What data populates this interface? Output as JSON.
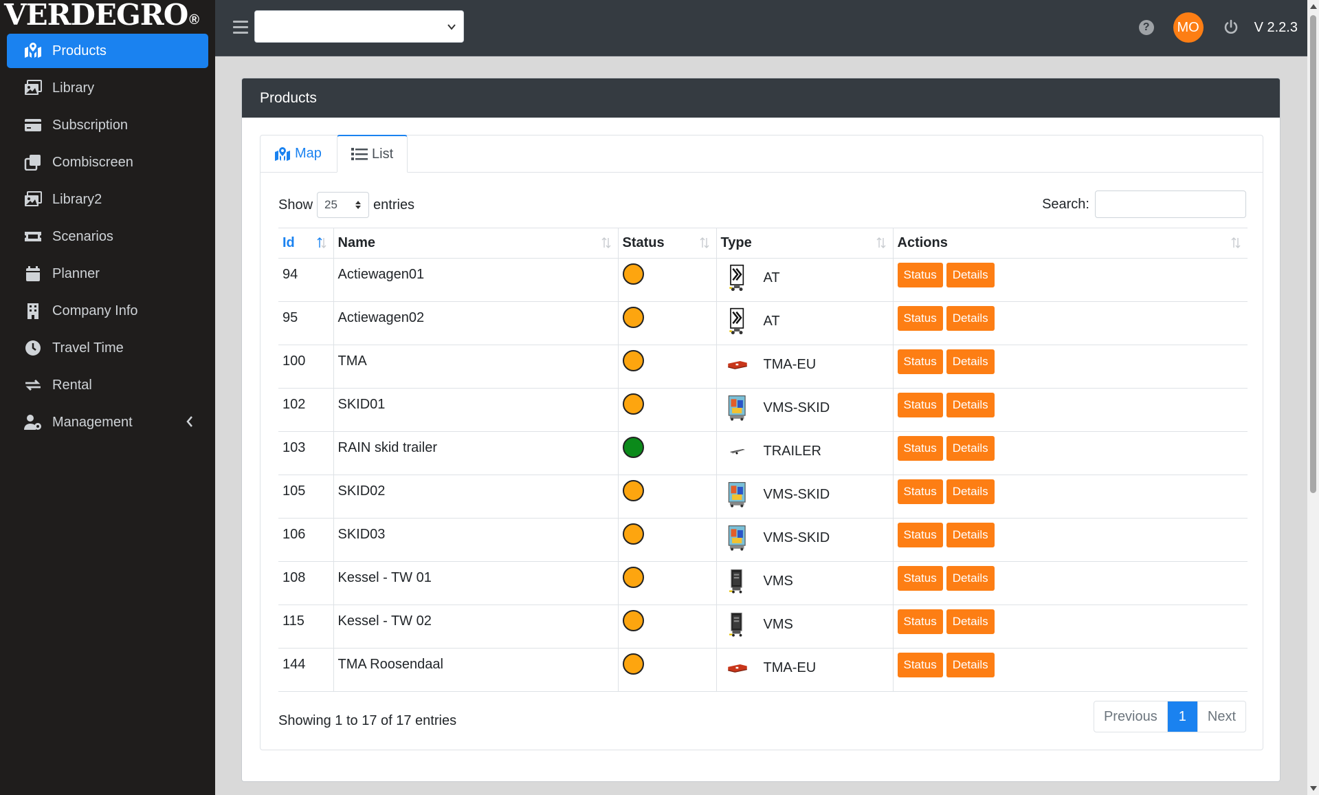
{
  "brand": {
    "logo": "VERDEGRO",
    "reg": "®"
  },
  "sidebar": {
    "items": [
      {
        "label": "Products",
        "icon": "map-marked-icon",
        "active": true
      },
      {
        "label": "Library",
        "icon": "images-icon"
      },
      {
        "label": "Subscription",
        "icon": "credit-card-icon"
      },
      {
        "label": "Combiscreen",
        "icon": "clone-icon"
      },
      {
        "label": "Library2",
        "icon": "images-icon"
      },
      {
        "label": "Scenarios",
        "icon": "ticket-icon"
      },
      {
        "label": "Planner",
        "icon": "calendar-icon"
      },
      {
        "label": "Company Info",
        "icon": "building-icon"
      },
      {
        "label": "Travel Time",
        "icon": "clock-icon"
      },
      {
        "label": "Rental",
        "icon": "exchange-icon"
      },
      {
        "label": "Management",
        "icon": "users-cog-icon",
        "has_submenu": true
      }
    ]
  },
  "topbar": {
    "select_value": "",
    "help_label": "?",
    "avatar": "MO",
    "version": "V 2.2.3"
  },
  "card": {
    "title": "Products",
    "tabs": {
      "map": "Map",
      "list": "List"
    }
  },
  "table_controls": {
    "show_label": "Show",
    "entries_value": "25",
    "entries_label": "entries",
    "search_label": "Search:"
  },
  "table": {
    "headers": {
      "id": "Id",
      "name": "Name",
      "status": "Status",
      "type": "Type",
      "actions": "Actions"
    },
    "rows": [
      {
        "id": "94",
        "name": "Actiewagen01",
        "status_color": "#fda50f",
        "type_icon": "arrow-board-icon",
        "type": "AT"
      },
      {
        "id": "95",
        "name": "Actiewagen02",
        "status_color": "#fda50f",
        "type_icon": "arrow-board-icon",
        "type": "AT"
      },
      {
        "id": "100",
        "name": "TMA",
        "status_color": "#fda50f",
        "type_icon": "tma-truck-icon",
        "type": "TMA-EU"
      },
      {
        "id": "102",
        "name": "SKID01",
        "status_color": "#fda50f",
        "type_icon": "vms-skid-icon",
        "type": "VMS-SKID"
      },
      {
        "id": "103",
        "name": "RAIN skid trailer",
        "status_color": "#0b8a1a",
        "type_icon": "trailer-icon",
        "type": "TRAILER"
      },
      {
        "id": "105",
        "name": "SKID02",
        "status_color": "#fda50f",
        "type_icon": "vms-skid-icon",
        "type": "VMS-SKID"
      },
      {
        "id": "106",
        "name": "SKID03",
        "status_color": "#fda50f",
        "type_icon": "vms-skid-icon",
        "type": "VMS-SKID"
      },
      {
        "id": "108",
        "name": "Kessel - TW 01",
        "status_color": "#fda50f",
        "type_icon": "vms-icon",
        "type": "VMS"
      },
      {
        "id": "115",
        "name": "Kessel - TW 02",
        "status_color": "#fda50f",
        "type_icon": "vms-icon",
        "type": "VMS"
      },
      {
        "id": "144",
        "name": "TMA Roosendaal",
        "status_color": "#fda50f",
        "type_icon": "tma-truck-icon",
        "type": "TMA-EU"
      }
    ],
    "status_button": "Status",
    "details_button": "Details"
  },
  "footer": {
    "info": "Showing 1 to 17 of 17 entries",
    "prev": "Previous",
    "page": "1",
    "next": "Next"
  },
  "colors": {
    "accent": "#1a82f0",
    "orange": "#fd7e14",
    "sidebar": "#1f1d1c",
    "topbar": "#353b41"
  }
}
